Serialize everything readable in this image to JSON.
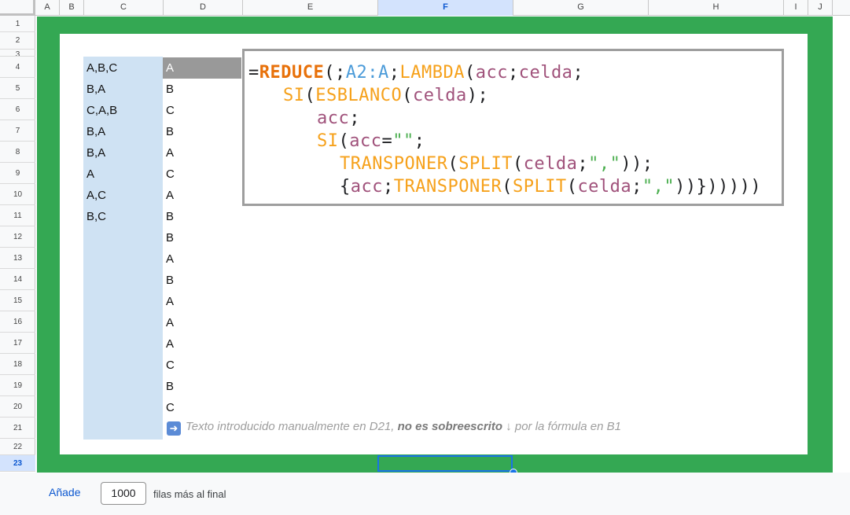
{
  "columns": [
    {
      "label": "A"
    },
    {
      "label": "B"
    },
    {
      "label": "C"
    },
    {
      "label": "D"
    },
    {
      "label": "E"
    },
    {
      "label": "F"
    },
    {
      "label": "G"
    },
    {
      "label": "H"
    },
    {
      "label": "I"
    },
    {
      "label": "J"
    }
  ],
  "active_column": "F",
  "rows": [
    "1",
    "2",
    "3",
    "4",
    "5",
    "6",
    "7",
    "8",
    "9",
    "10",
    "11",
    "12",
    "13",
    "14",
    "15",
    "16",
    "17",
    "18",
    "19",
    "20",
    "21",
    "22",
    "23"
  ],
  "active_row": "23",
  "column_c_values": [
    "A,B,C",
    "B,A",
    "C,A,B",
    "B,A",
    "B,A",
    "A",
    "A,C",
    "B,C"
  ],
  "column_d_values": [
    "A",
    "B",
    "C",
    "B",
    "A",
    "C",
    "A",
    "B",
    "B",
    "A",
    "B",
    "A",
    "A",
    "A",
    "C",
    "B",
    "C"
  ],
  "formula": {
    "l1_eq": "=",
    "l1_reduce": "REDUCE",
    "l1_open": "(;",
    "l1_ref": "A2:A",
    "l1_sep": ";",
    "l1_lambda": "LAMBDA",
    "l1_open2": "(",
    "l1_acc": "acc",
    "l1_sep2": ";",
    "l1_celda": "celda",
    "l1_end": ";",
    "l2_si": "SI",
    "l2_open": "(",
    "l2_esblanco": "ESBLANCO",
    "l2_open2": "(",
    "l2_celda": "celda",
    "l2_end": ");",
    "l3_acc": "acc",
    "l3_end": ";",
    "l4_si": "SI",
    "l4_open": "(",
    "l4_acc": "acc",
    "l4_eq": "=",
    "l4_str": "\"\"",
    "l4_end": ";",
    "l5_transponer": "TRANSPONER",
    "l5_open": "(",
    "l5_split": "SPLIT",
    "l5_open2": "(",
    "l5_celda": "celda",
    "l5_sep": ";",
    "l5_str": "\",\"",
    "l5_end": "));",
    "l6_open": "{",
    "l6_acc": "acc",
    "l6_sep": ";",
    "l6_transponer": "TRANSPONER",
    "l6_open2": "(",
    "l6_split": "SPLIT",
    "l6_open3": "(",
    "l6_celda": "celda",
    "l6_sep2": ";",
    "l6_str": "\",\"",
    "l6_end": "))})))))"
  },
  "note": {
    "icon": "arrow-right-icon",
    "part1": "Texto introducido manualmente en D21, ",
    "bold": "no es sobreescrito",
    "part2": " ↓ por la fórmula en B1"
  },
  "footer": {
    "add_label": "Añade",
    "rows_value": "1000",
    "suffix": "filas más al final"
  },
  "colors": {
    "frame_green": "#34a853",
    "column_c_fill": "#cfe2f3",
    "selection_blue": "#1a73e8"
  }
}
